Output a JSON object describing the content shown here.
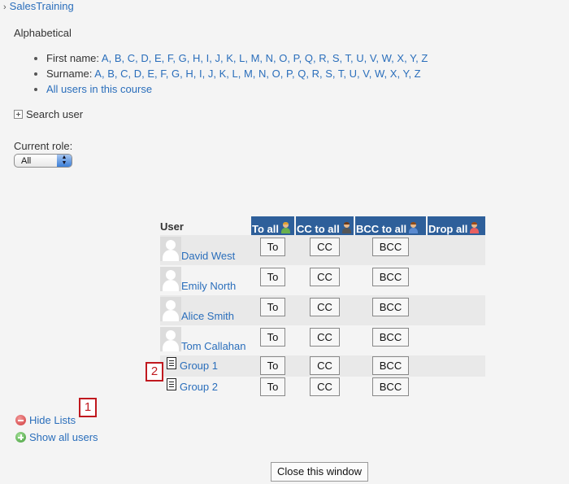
{
  "breadcrumb": {
    "separator": "›",
    "link": "SalesTraining"
  },
  "alphabetical": {
    "title": "Alphabetical",
    "first_name_label": "First name:",
    "surname_label": "Surname:",
    "letters": [
      "A",
      "B",
      "C",
      "D",
      "E",
      "F",
      "G",
      "H",
      "I",
      "J",
      "K",
      "L",
      "M",
      "N",
      "O",
      "P",
      "Q",
      "R",
      "S",
      "T",
      "U",
      "V",
      "W",
      "X",
      "Y",
      "Z"
    ],
    "all_users_link": "All users in this course"
  },
  "search": {
    "label": "Search user"
  },
  "role": {
    "label": "Current role:",
    "selected": "All"
  },
  "table": {
    "user_header": "User",
    "actions": [
      {
        "label": "To all",
        "icon": "person-green-icon",
        "hair": "#e0a030",
        "body": "#6ab04c"
      },
      {
        "label": "CC to all",
        "icon": "person-gray-icon",
        "hair": "#6b3a1a",
        "body": "#555555"
      },
      {
        "label": "BCC to all",
        "icon": "person-blue-icon",
        "hair": "#8a4a1a",
        "body": "#5a8ad0"
      },
      {
        "label": "Drop all",
        "icon": "person-red-icon",
        "hair": "#9a4a1a",
        "body": "#e86060"
      }
    ],
    "users": [
      {
        "name": "David West"
      },
      {
        "name": "Emily North"
      },
      {
        "name": "Alice Smith"
      },
      {
        "name": "Tom Callahan"
      }
    ],
    "groups": [
      {
        "name": "Group 1"
      },
      {
        "name": "Group 2"
      }
    ],
    "button_labels": {
      "to": "To",
      "cc": "CC",
      "bcc": "BCC"
    }
  },
  "callouts": {
    "one": "1",
    "two": "2"
  },
  "links": {
    "hide_lists": "Hide Lists",
    "show_all_users": "Show all users"
  },
  "close_button": "Close this window"
}
